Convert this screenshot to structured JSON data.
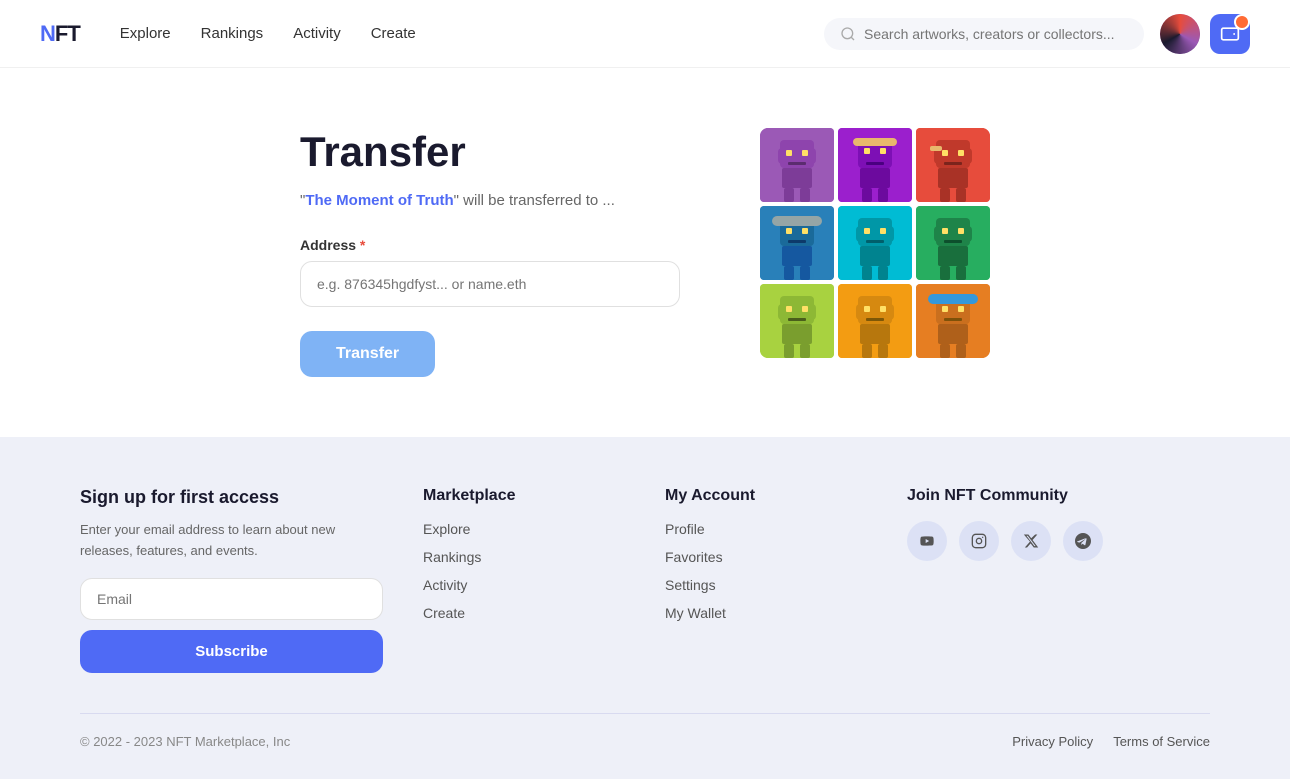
{
  "brand": {
    "name_part1": "N",
    "name_part2": "FT",
    "logo_text": "NFT"
  },
  "nav": {
    "items": [
      {
        "label": "Explore",
        "id": "explore"
      },
      {
        "label": "Rankings",
        "id": "rankings"
      },
      {
        "label": "Activity",
        "id": "activity"
      },
      {
        "label": "Create",
        "id": "create"
      }
    ]
  },
  "search": {
    "placeholder": "Search artworks, creators or collectors..."
  },
  "transfer": {
    "title": "Transfer",
    "subtitle_pre": "\"",
    "subtitle_highlight": "The Moment of Truth",
    "subtitle_post": "\" will be transferred to ...",
    "address_label": "Address",
    "address_placeholder": "e.g. 876345hgdfyst... or name.eth",
    "button_label": "Transfer"
  },
  "nft_grid": {
    "colors": [
      "#9b59b6",
      "#9b1fcd",
      "#e74c3c",
      "#2980b9",
      "#8e44ad",
      "#27ae60",
      "#a8d240",
      "#f39c12",
      "#e67e22"
    ]
  },
  "footer": {
    "signup": {
      "title": "Sign up for first access",
      "description": "Enter your email address to learn about new releases, features, and events.",
      "email_placeholder": "Email",
      "subscribe_label": "Subscribe"
    },
    "marketplace": {
      "title": "Marketplace",
      "items": [
        "Explore",
        "Rankings",
        "Activity",
        "Create"
      ]
    },
    "my_account": {
      "title": "My Account",
      "items": [
        "Profile",
        "Favorites",
        "Settings",
        "My Wallet"
      ]
    },
    "community": {
      "title": "Join NFT Community",
      "socials": [
        {
          "name": "youtube",
          "icon": "▶"
        },
        {
          "name": "instagram",
          "icon": "◉"
        },
        {
          "name": "twitter",
          "icon": "✕"
        },
        {
          "name": "telegram",
          "icon": "➤"
        }
      ]
    },
    "copyright": "© 2022 - 2023 NFT Marketplace, Inc",
    "privacy_label": "Privacy Policy",
    "terms_label": "Terms of Service"
  }
}
